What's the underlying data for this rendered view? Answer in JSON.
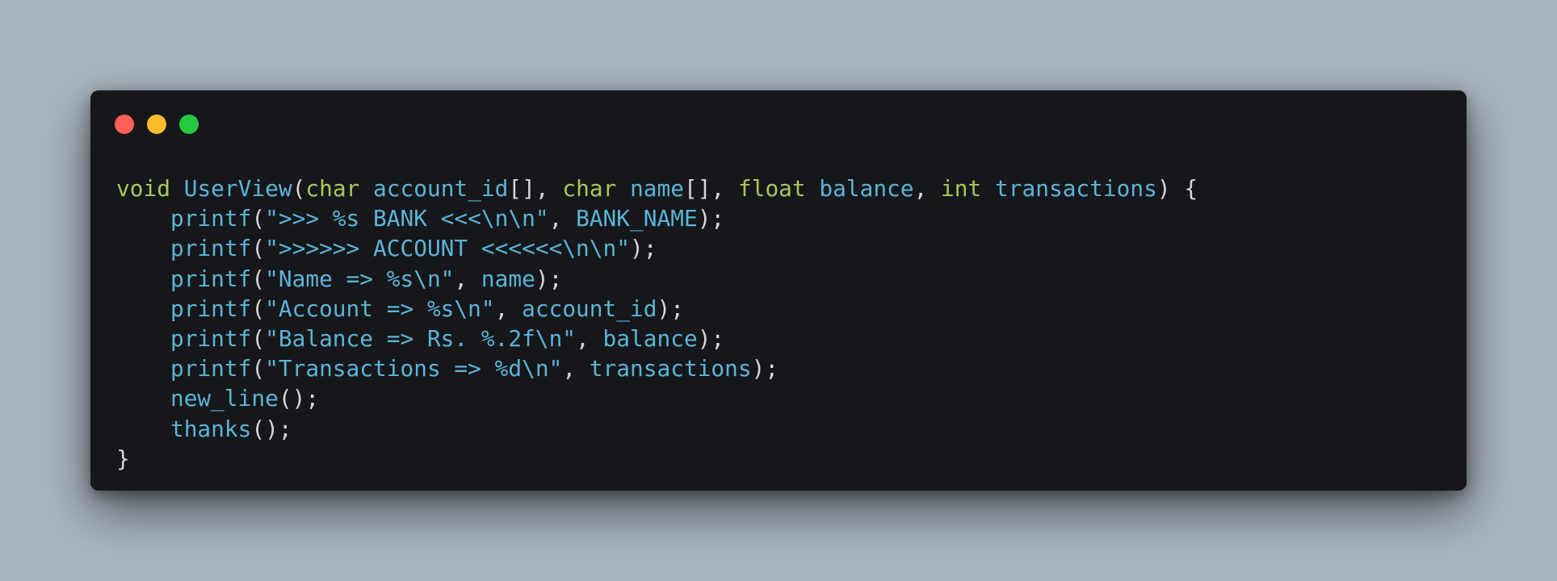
{
  "window": {
    "traffic_lights": [
      {
        "name": "close",
        "color": "#ff5f57"
      },
      {
        "name": "minimize",
        "color": "#febc2e"
      },
      {
        "name": "maximize",
        "color": "#28c840"
      }
    ]
  },
  "colors": {
    "background": "#a9b4bf",
    "window_bg": "#16171a",
    "keyword": "#a6c95b",
    "identifier": "#5ab4d8",
    "punctuation": "#d6d6d6"
  },
  "code": {
    "language": "c",
    "lines": [
      [
        {
          "t": "void",
          "k": "kw"
        },
        {
          "t": " ",
          "k": "punc"
        },
        {
          "t": "UserView",
          "k": "fn"
        },
        {
          "t": "(",
          "k": "punc"
        },
        {
          "t": "char",
          "k": "kw"
        },
        {
          "t": " ",
          "k": "punc"
        },
        {
          "t": "account_id",
          "k": "id"
        },
        {
          "t": "[], ",
          "k": "punc"
        },
        {
          "t": "char",
          "k": "kw"
        },
        {
          "t": " ",
          "k": "punc"
        },
        {
          "t": "name",
          "k": "id"
        },
        {
          "t": "[], ",
          "k": "punc"
        },
        {
          "t": "float",
          "k": "kw"
        },
        {
          "t": " ",
          "k": "punc"
        },
        {
          "t": "balance",
          "k": "id"
        },
        {
          "t": ", ",
          "k": "punc"
        },
        {
          "t": "int",
          "k": "kw"
        },
        {
          "t": " ",
          "k": "punc"
        },
        {
          "t": "transactions",
          "k": "id"
        },
        {
          "t": ") {",
          "k": "punc"
        }
      ],
      [
        {
          "t": "    ",
          "k": "punc"
        },
        {
          "t": "printf",
          "k": "fn"
        },
        {
          "t": "(",
          "k": "punc"
        },
        {
          "t": "\">>> %s BANK <<<\\n\\n\"",
          "k": "str"
        },
        {
          "t": ", ",
          "k": "punc"
        },
        {
          "t": "BANK_NAME",
          "k": "id"
        },
        {
          "t": ");",
          "k": "punc"
        }
      ],
      [
        {
          "t": "    ",
          "k": "punc"
        },
        {
          "t": "printf",
          "k": "fn"
        },
        {
          "t": "(",
          "k": "punc"
        },
        {
          "t": "\">>>>>> ACCOUNT <<<<<<\\n\\n\"",
          "k": "str"
        },
        {
          "t": ");",
          "k": "punc"
        }
      ],
      [
        {
          "t": "    ",
          "k": "punc"
        },
        {
          "t": "printf",
          "k": "fn"
        },
        {
          "t": "(",
          "k": "punc"
        },
        {
          "t": "\"Name => %s\\n\"",
          "k": "str"
        },
        {
          "t": ", ",
          "k": "punc"
        },
        {
          "t": "name",
          "k": "id"
        },
        {
          "t": ");",
          "k": "punc"
        }
      ],
      [
        {
          "t": "    ",
          "k": "punc"
        },
        {
          "t": "printf",
          "k": "fn"
        },
        {
          "t": "(",
          "k": "punc"
        },
        {
          "t": "\"Account => %s\\n\"",
          "k": "str"
        },
        {
          "t": ", ",
          "k": "punc"
        },
        {
          "t": "account_id",
          "k": "id"
        },
        {
          "t": ");",
          "k": "punc"
        }
      ],
      [
        {
          "t": "    ",
          "k": "punc"
        },
        {
          "t": "printf",
          "k": "fn"
        },
        {
          "t": "(",
          "k": "punc"
        },
        {
          "t": "\"Balance => Rs. %.2f\\n\"",
          "k": "str"
        },
        {
          "t": ", ",
          "k": "punc"
        },
        {
          "t": "balance",
          "k": "id"
        },
        {
          "t": ");",
          "k": "punc"
        }
      ],
      [
        {
          "t": "    ",
          "k": "punc"
        },
        {
          "t": "printf",
          "k": "fn"
        },
        {
          "t": "(",
          "k": "punc"
        },
        {
          "t": "\"Transactions => %d\\n\"",
          "k": "str"
        },
        {
          "t": ", ",
          "k": "punc"
        },
        {
          "t": "transactions",
          "k": "id"
        },
        {
          "t": ");",
          "k": "punc"
        }
      ],
      [
        {
          "t": "    ",
          "k": "punc"
        },
        {
          "t": "new_line",
          "k": "fn"
        },
        {
          "t": "();",
          "k": "punc"
        }
      ],
      [
        {
          "t": "    ",
          "k": "punc"
        },
        {
          "t": "thanks",
          "k": "fn"
        },
        {
          "t": "();",
          "k": "punc"
        }
      ],
      [
        {
          "t": "}",
          "k": "punc"
        }
      ]
    ]
  }
}
